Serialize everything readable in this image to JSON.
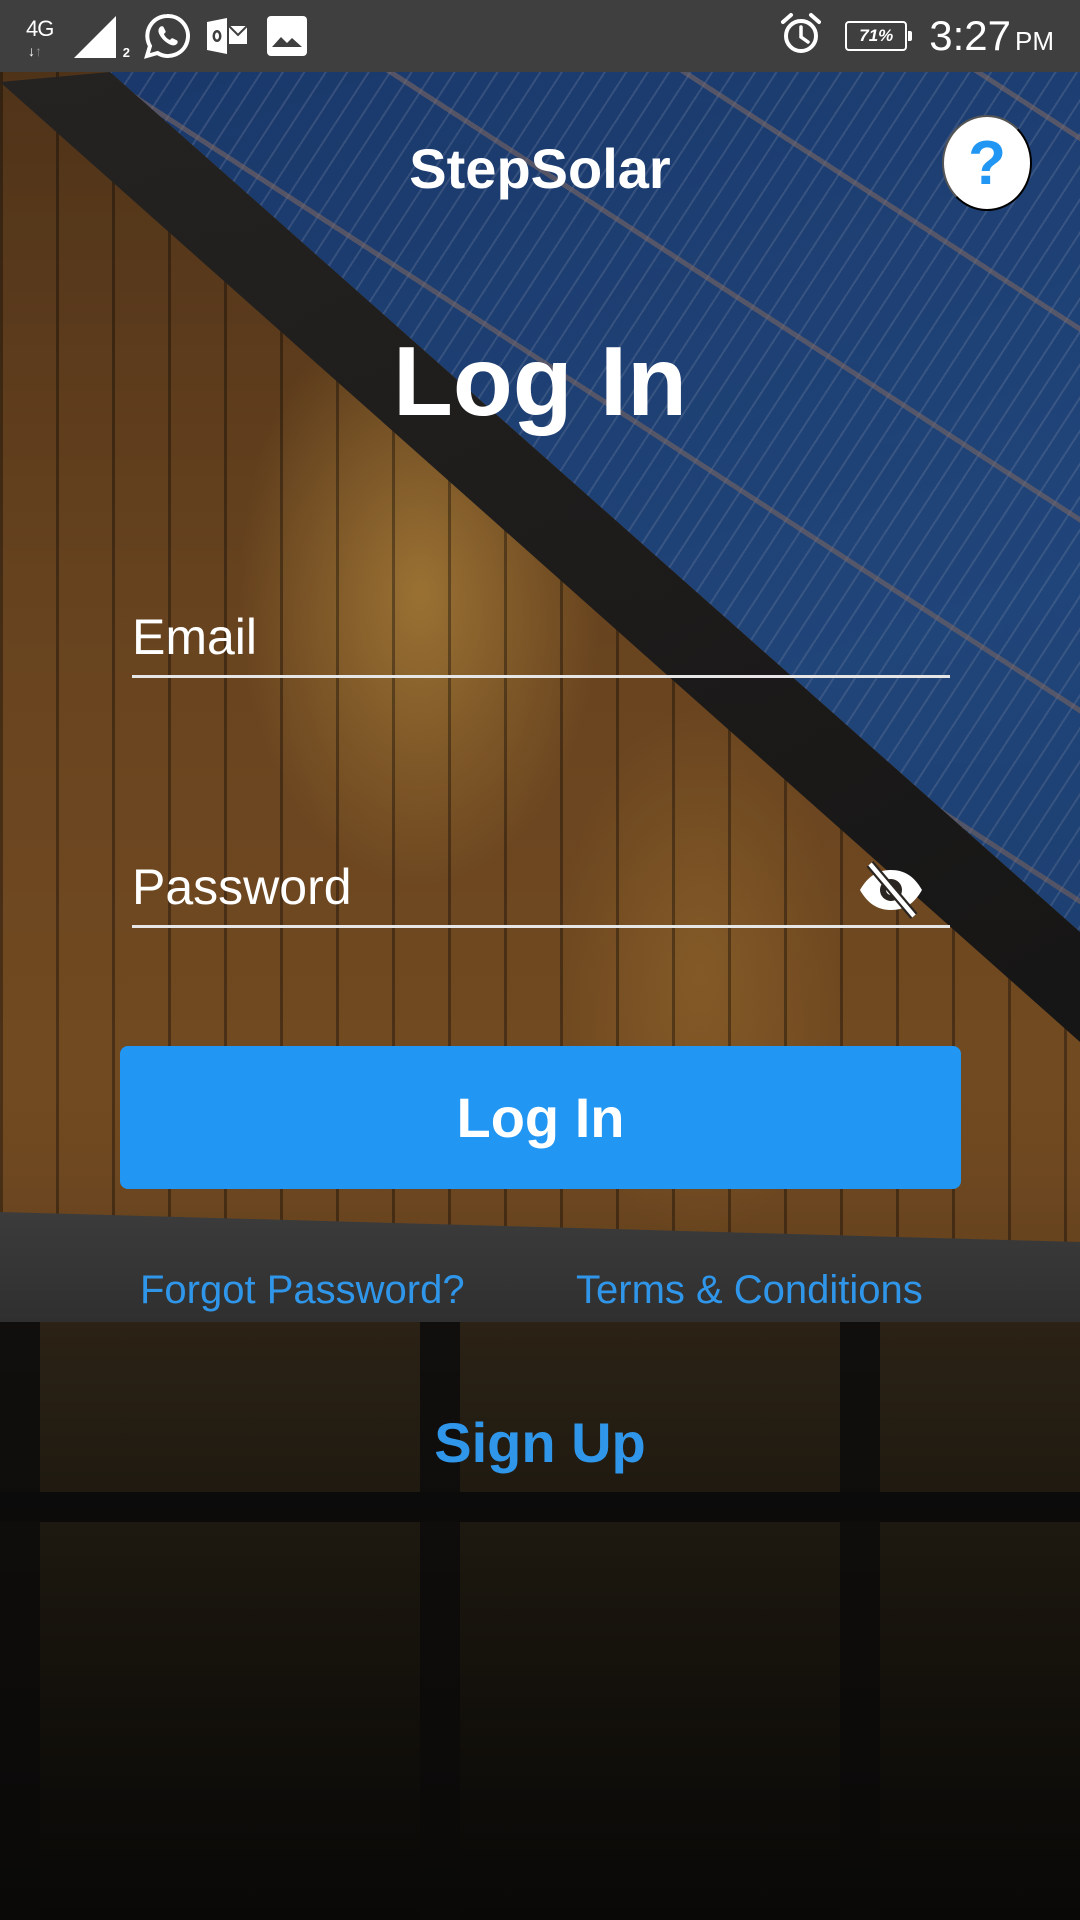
{
  "status_bar": {
    "network_type": "4G",
    "sim_slot": "2",
    "notification_icons": [
      "whatsapp-icon",
      "outlook-icon",
      "gallery-icon"
    ],
    "battery_percent": "71%",
    "time": "3:27",
    "ampm": "PM"
  },
  "header": {
    "brand": "StepSolar",
    "help_label": "?"
  },
  "page": {
    "title": "Log In"
  },
  "form": {
    "email": {
      "placeholder": "Email",
      "value": ""
    },
    "password": {
      "placeholder": "Password",
      "value": "",
      "visibility_icon": "eye-off-icon"
    },
    "submit_label": "Log In"
  },
  "links": {
    "forgot_password": "Forgot Password?",
    "terms": "Terms & Conditions",
    "sign_up": "Sign Up"
  },
  "colors": {
    "accent": "#2196f3",
    "link": "#2f96ea",
    "status_bar": "#3f3f3f"
  }
}
